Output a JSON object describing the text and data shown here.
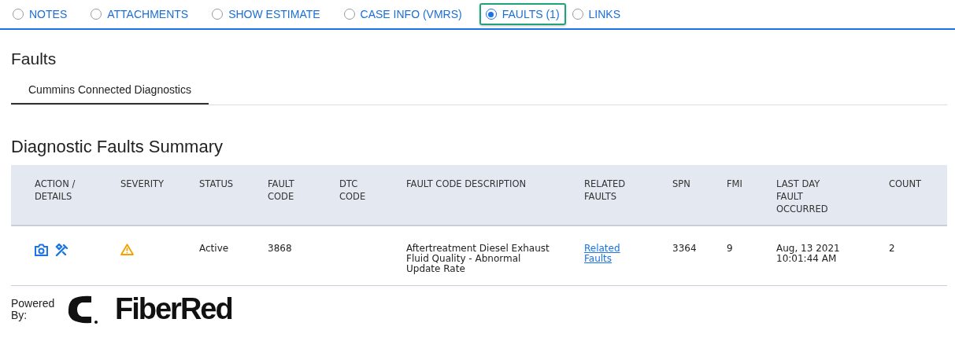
{
  "tabs": [
    {
      "label": "NOTES",
      "selected": false
    },
    {
      "label": "ATTACHMENTS",
      "selected": false
    },
    {
      "label": "SHOW ESTIMATE",
      "selected": false
    },
    {
      "label": "CASE INFO (VMRS)",
      "selected": false
    },
    {
      "label": "FAULTS (1)",
      "selected": true
    },
    {
      "label": "LINKS",
      "selected": false
    }
  ],
  "page_title": "Faults",
  "subtabs": [
    {
      "label": "Cummins Connected Diagnostics",
      "selected": true
    }
  ],
  "section_title": "Diagnostic Faults Summary",
  "table": {
    "columns": [
      "ACTION / DETAILS",
      "SEVERITY",
      "STATUS",
      "FAULT CODE",
      "DTC CODE",
      "FAULT CODE DESCRIPTION",
      "RELATED FAULTS",
      "SPN",
      "FMI",
      "LAST DAY FAULT OCCURRED",
      "COUNT"
    ],
    "rows": [
      {
        "kind": "warning",
        "status": "Active",
        "fault_code": "3868",
        "description": "Aftertreatment Diesel Exhaust Fluid Quality - Abnormal Update Rate",
        "related_faults": "Related Faults",
        "spn": "3364",
        "fmi": "9",
        "last_day": "Aug, 13 2021 10:01:44 AM",
        "count": "2"
      }
    ]
  },
  "footer": {
    "powered_by": "Powered By:",
    "brand": "FiberRed"
  }
}
